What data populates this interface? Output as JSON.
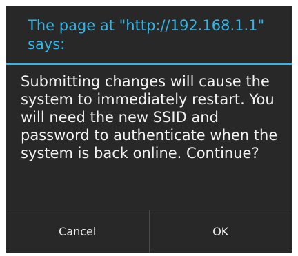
{
  "dialog": {
    "title": "The page at \"http://192.168.1.1\" says:",
    "message": "Submitting changes will cause the system to immediately restart. You will need the new SSID and password to authenticate when the system is back online. Continue?",
    "buttons": {
      "cancel_label": "Cancel",
      "ok_label": "OK"
    }
  },
  "colors": {
    "accent": "#33b5e5",
    "dialog_background": "#282828",
    "text": "#f2f2f2",
    "divider": "#4a4a4a"
  }
}
